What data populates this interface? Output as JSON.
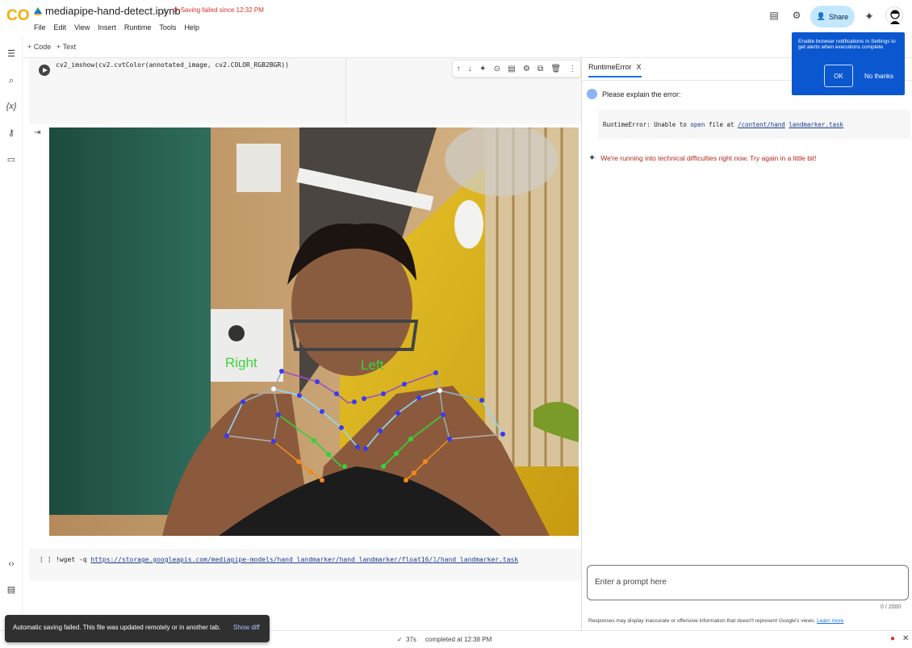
{
  "topbar": {
    "notebook_title": "mediapipe-hand-detect.ipynb",
    "save_status": "Saving failed since 12:32 PM",
    "share_label": "Share"
  },
  "menu": [
    "File",
    "Edit",
    "View",
    "Insert",
    "Runtime",
    "Tools",
    "Help"
  ],
  "toolbar": {
    "add_code": "+ Code",
    "add_text": "+ Text"
  },
  "cells": {
    "cell1_code": "cv2_imshow(cv2.cvtColor(annotated_image, cv2.COLOR_RGB2BGR))",
    "cell2_bracket": "[ ]",
    "cell2_cmd": "!wget -q ",
    "cell2_url_a": "https://storage.googleapis.com/mediapipe-models/hand_landmarker/hand_landmarker/float16/",
    "cell2_url_num": "1",
    "cell2_url_b": "/hand_landmarker.task"
  },
  "image_labels": {
    "right": "Right",
    "left": "Left"
  },
  "panel": {
    "tab_label": "RuntimeError",
    "tab_close": "X",
    "user_message": "Please explain the error:",
    "error_prefix": "RuntimeError: Unable to ",
    "error_kw1": "open",
    "error_mid": " file at ",
    "error_path_a": "/content/hand",
    "error_path_b": "landmarker.task",
    "gemini_reply": "We're running into technical difficulties right now. Try again in a little bit!",
    "prompt_placeholder": "Enter a prompt here",
    "counter": "0 / 2000",
    "disclaimer": "Responses may display inaccurate or offensive information that doesn't represent Google's views.",
    "learn_more": "Learn more"
  },
  "notification": {
    "text": "Enable browser notifications in Settings to get alerts when executions complete",
    "ok": "OK",
    "no": "No thanks"
  },
  "status": {
    "check": "✓",
    "elapsed": "37s",
    "completed": "completed at 12:38 PM"
  },
  "toast": {
    "message": "Automatic saving failed. This file was updated remotely or in another tab.",
    "action": "Show diff"
  },
  "colors": {
    "accent": "#0b57d0",
    "error": "#d93025"
  }
}
